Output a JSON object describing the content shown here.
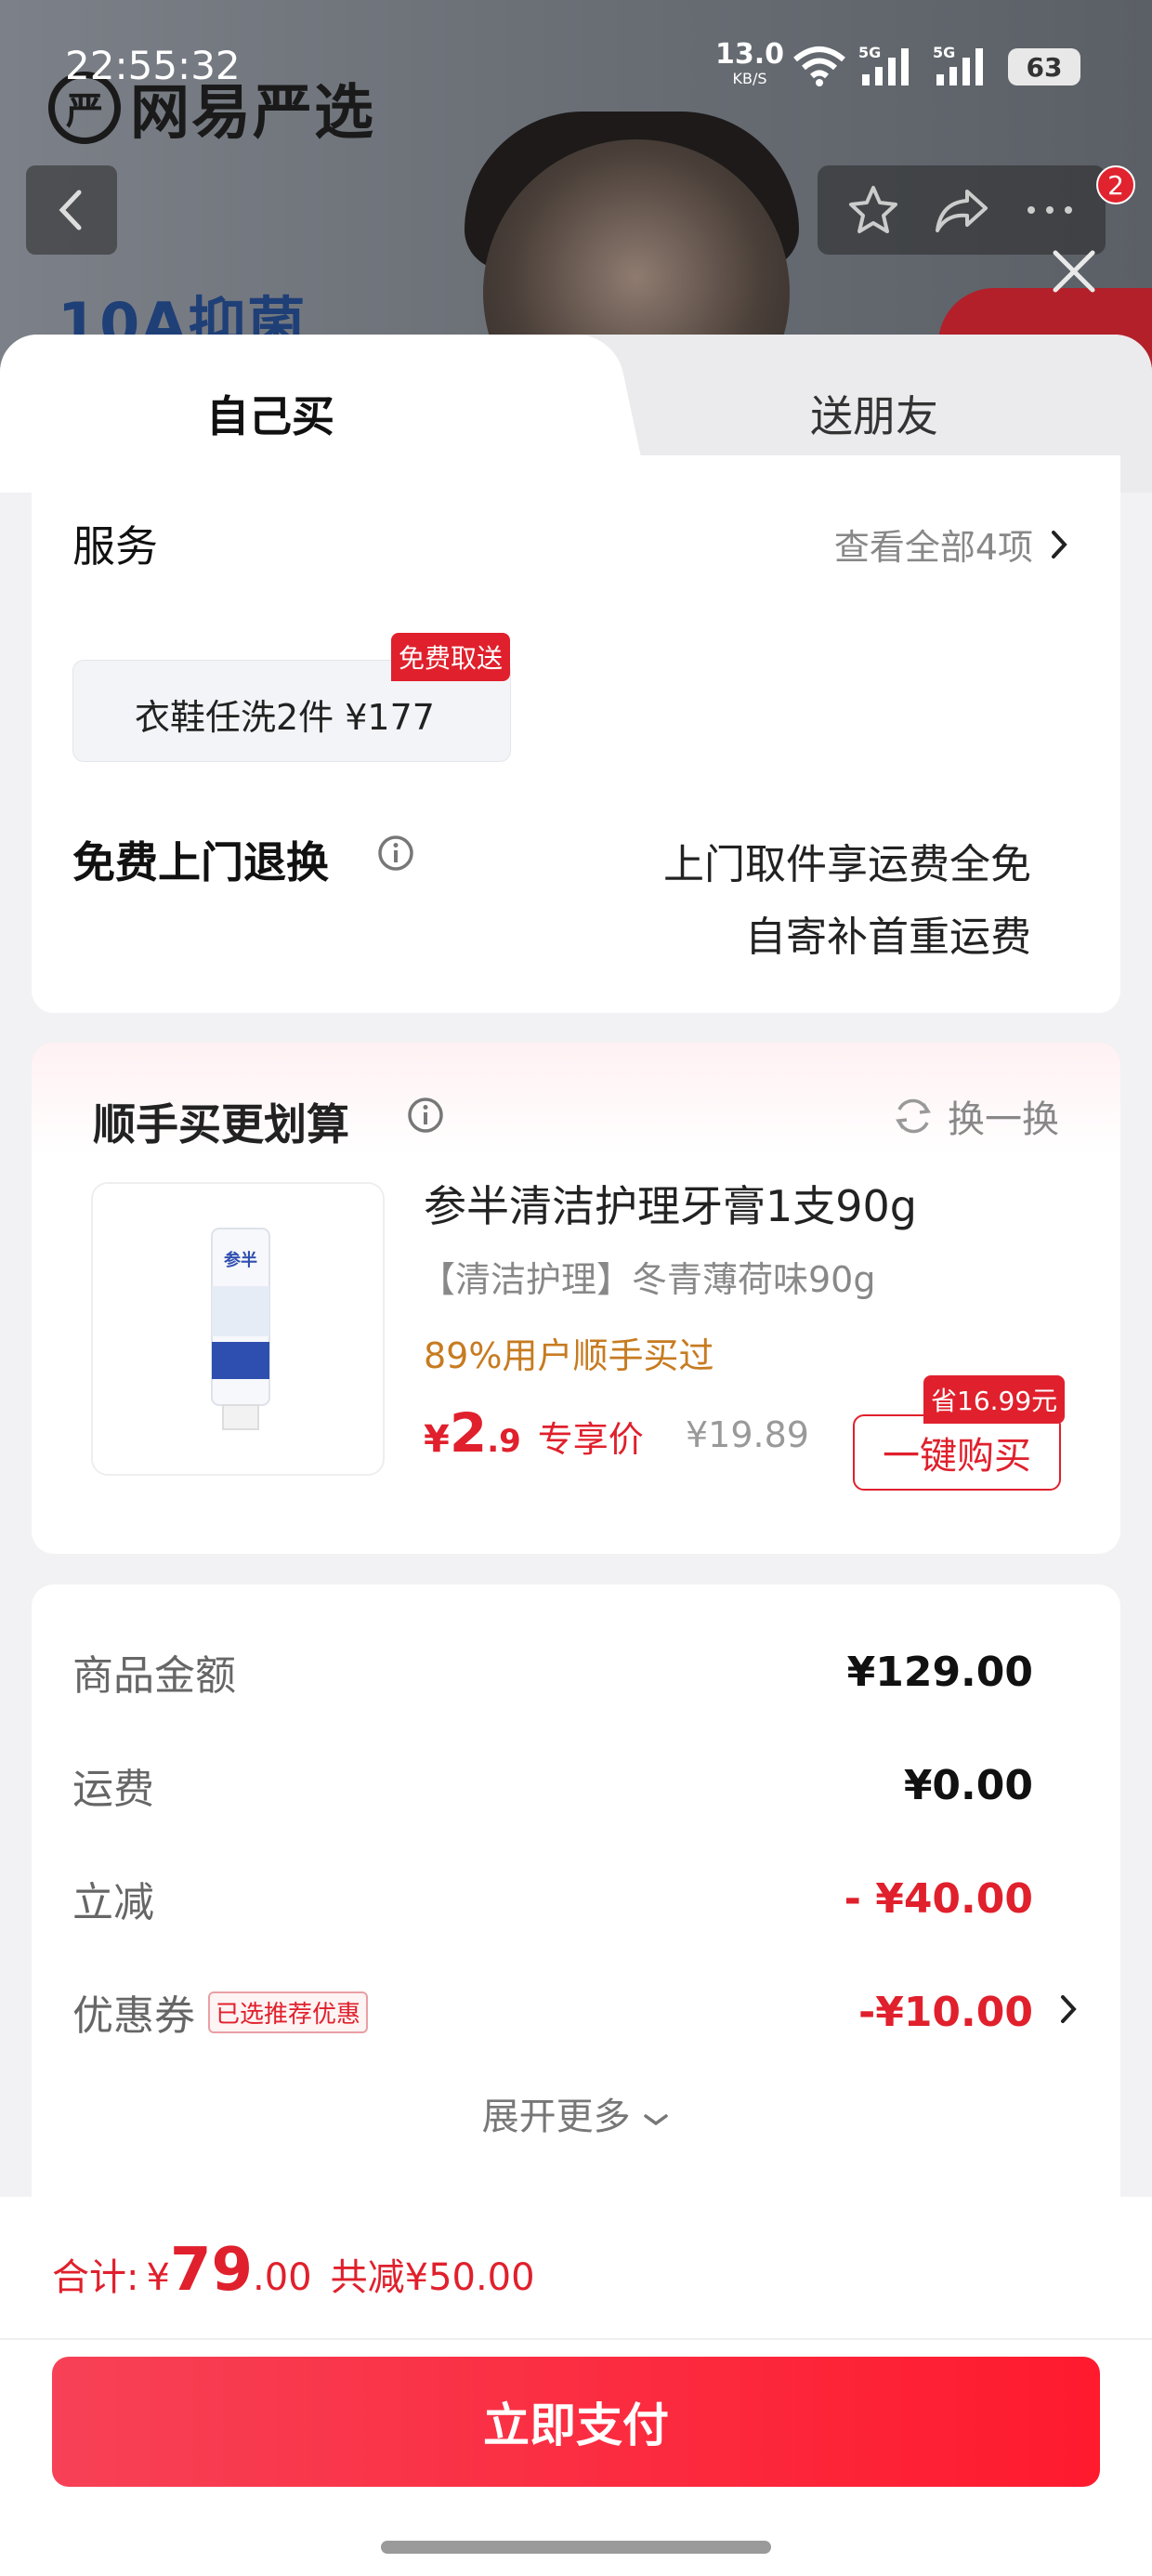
{
  "statusbar": {
    "time": "22:55:32",
    "speed_value": "13.0",
    "speed_unit": "KB/S",
    "battery": "63"
  },
  "brand": {
    "logo_glyph": "严",
    "name": "网易严选"
  },
  "backdrop": {
    "promo_text": "10A抑菌"
  },
  "nav": {
    "notification_count": "2"
  },
  "tabs": {
    "self": "自己买",
    "friend": "送朋友"
  },
  "service": {
    "title": "服务",
    "view_all": "查看全部4项",
    "chip_text": "衣鞋任洗2件  ¥177",
    "chip_tag": "免费取送",
    "return_title": "免费上门退换",
    "return_line1": "上门取件享运费全免",
    "return_line2": "自寄补首重运费"
  },
  "addon": {
    "title": "顺手买更划算",
    "swap_label": "换一换",
    "product_name": "参半清洁护理牙膏1支90g",
    "product_spec": "【清洁护理】冬青薄荷味90g",
    "social_proof": "89%用户顺手买过",
    "price_currency": "¥",
    "price_int": "2",
    "price_dec": ".9",
    "price_label": "专享价",
    "original_price": "¥19.89",
    "buy_button": "一键购买",
    "save_tag": "省16.99元",
    "image_brand": "参半"
  },
  "price": {
    "rows": [
      {
        "label": "商品金额",
        "value": "¥129.00"
      },
      {
        "label": "运费",
        "value": "¥0.00"
      },
      {
        "label": "立减",
        "value": "- ¥40.00"
      },
      {
        "label": "优惠券",
        "value": "-¥10.00",
        "tag": "已选推荐优惠"
      }
    ],
    "expand": "展开更多"
  },
  "bottom": {
    "total_label": "合计:",
    "total_currency": "¥",
    "total_int": "79",
    "total_dec": ".00",
    "total_saved": "共减¥50.00",
    "pay_button": "立即支付"
  },
  "colors": {
    "accent_red": "#e0202c",
    "social_orange": "#c77b20"
  }
}
